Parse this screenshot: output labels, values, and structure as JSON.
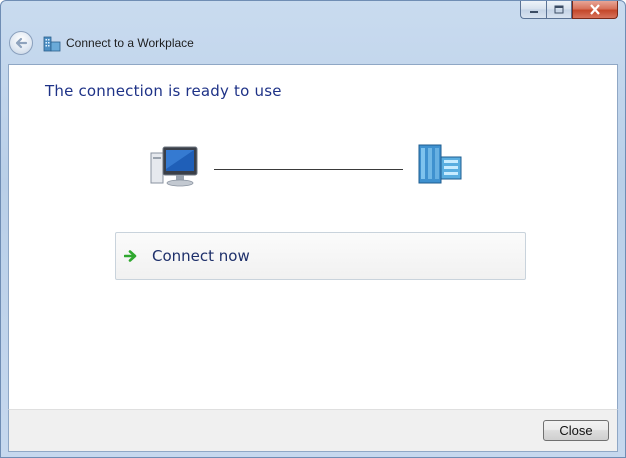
{
  "window": {
    "title": "Connect to a Workplace",
    "caption_buttons": [
      "minimize-icon",
      "maximize-icon",
      "close-icon"
    ]
  },
  "nav": {
    "back_icon": "back-arrow-icon"
  },
  "main": {
    "headline": "The connection is ready to use",
    "diagram": {
      "left_icon": "computer-icon",
      "right_icon": "workplace-building-icon"
    },
    "command_link": {
      "label": "Connect now",
      "icon": "green-arrow-icon"
    }
  },
  "footer": {
    "close_label": "Close"
  },
  "colors": {
    "headline": "#1e3287",
    "link_text": "#1d2f6a",
    "arrow": "#2fa82f"
  }
}
